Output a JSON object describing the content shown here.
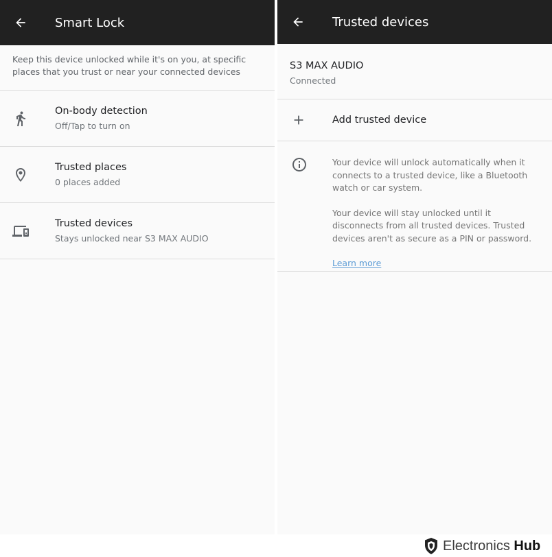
{
  "left": {
    "title": "Smart Lock",
    "description": "Keep this device unlocked while it's on you, at specific places that you trust or near your connected devices",
    "items": [
      {
        "icon": "walking-person-icon",
        "title": "On-body detection",
        "subtitle": "Off/Tap to turn on"
      },
      {
        "icon": "location-pin-icon",
        "title": "Trusted places",
        "subtitle": "0 places added"
      },
      {
        "icon": "devices-icon",
        "title": "Trusted devices",
        "subtitle": "Stays unlocked near S3 MAX AUDIO"
      }
    ]
  },
  "right": {
    "title": "Trusted devices",
    "device": {
      "name": "S3 MAX AUDIO",
      "status": "Connected"
    },
    "add_label": "Add trusted device",
    "info_paragraph_1": "Your device will unlock automatically when it connects to a trusted device, like a Bluetooth watch or car system.",
    "info_paragraph_2": "Your device will stay unlocked until it disconnects from all trusted devices. Trusted devices aren't as secure as a PIN or password.",
    "learn_more": "Learn more"
  },
  "watermark": {
    "brand_regular": "Electronics",
    "brand_bold": "Hub"
  },
  "colors": {
    "topbar": "#212121",
    "background": "#fafafa",
    "link": "#5b9bd5"
  }
}
